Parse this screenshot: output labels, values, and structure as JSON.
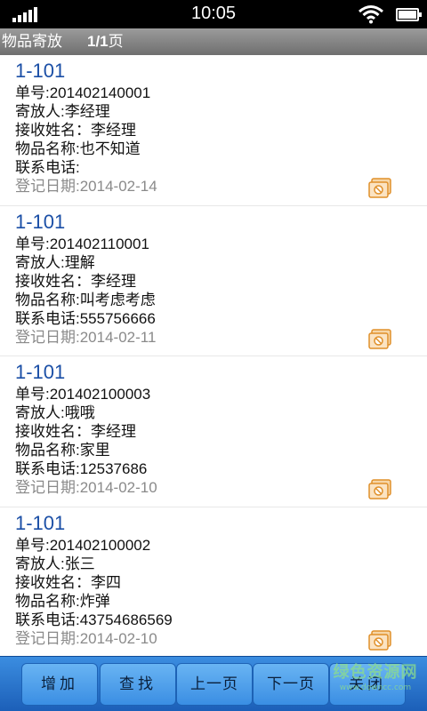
{
  "status": {
    "time": "10:05"
  },
  "header": {
    "title": "物品寄放",
    "page": "1/1",
    "page_unit": "页"
  },
  "items": [
    {
      "room": "1-101",
      "order": "单号:201402140001",
      "depositor": "寄放人:李经理",
      "receiver": "接收姓名：李经理",
      "goods": "物品名称:也不知道",
      "phone": "联系电话:",
      "date": "登记日期:2014-02-14"
    },
    {
      "room": "1-101",
      "order": "单号:201402110001",
      "depositor": "寄放人:理解",
      "receiver": "接收姓名：李经理",
      "goods": "物品名称:叫考虑考虑",
      "phone": "联系电话:555756666",
      "date": "登记日期:2014-02-11"
    },
    {
      "room": "1-101",
      "order": "单号:201402100003",
      "depositor": "寄放人:哦哦",
      "receiver": "接收姓名：李经理",
      "goods": "物品名称:家里",
      "phone": "联系电话:12537686",
      "date": "登记日期:2014-02-10"
    },
    {
      "room": "1-101",
      "order": "单号:201402100002",
      "depositor": "寄放人:张三",
      "receiver": "接收姓名：李四",
      "goods": "物品名称:炸弹",
      "phone": "联系电话:43754686569",
      "date": "登记日期:2014-02-10"
    }
  ],
  "toolbar": {
    "add": "增加",
    "find": "查找",
    "prev": "上一页",
    "next": "下一页",
    "close": "关闭"
  },
  "watermark": {
    "text": "绿色资源网",
    "sub": "www.downcc.com"
  },
  "colors": {
    "accent": "#1b4fa6",
    "toolbar": "#2f7fd6"
  },
  "icons": {
    "item_thumbnail": "image-thumbnail-icon"
  }
}
